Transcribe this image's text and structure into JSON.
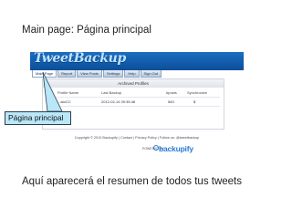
{
  "captions": {
    "top": "Main page: Página principal",
    "bottom": "Aquí aparecerá el resumen de todos tus tweets"
  },
  "screenshot": {
    "logo": "TweetBackup",
    "nav_tabs": [
      "Main Page",
      "Report",
      "View Posts",
      "Settings",
      "Help",
      "Sign Out"
    ],
    "panel": {
      "title": "Archived Profiles",
      "headers": [
        "Profile Name",
        "Last Backup",
        "#posts",
        "Synchronize"
      ],
      "row": [
        "...atoCC",
        "2012-02-14 09:35:48",
        "583",
        "$"
      ]
    },
    "powered_by": "POWERED BY",
    "brand": "backupify",
    "footer": "Copyright © 2010 Backupify | Contact | Privacy Policy | Follow us: @tweetbackup"
  },
  "callout": {
    "label": "Página principal"
  },
  "colors": {
    "header_blue": "#0b4f99",
    "callout_fill": "#b9e7f7",
    "brand_blue": "#2a7bd6"
  }
}
